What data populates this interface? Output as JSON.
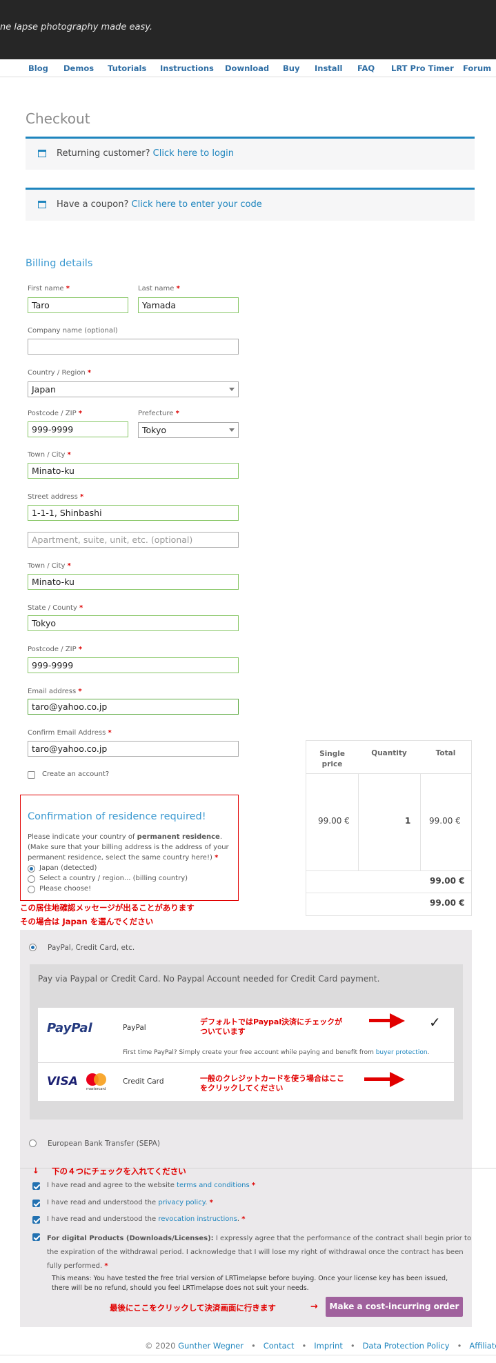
{
  "header": {
    "tagline": "ne lapse photography made easy."
  },
  "nav": {
    "items": [
      "Blog",
      "Demos",
      "Tutorials",
      "Instructions",
      "Download",
      "Buy",
      "Install",
      "FAQ",
      "LRT Pro Timer",
      "Forum"
    ]
  },
  "page_title": "Checkout",
  "notices": {
    "returning": {
      "text": "Returning customer?",
      "link": "Click here to login"
    },
    "coupon": {
      "text": "Have a coupon?",
      "link": "Click here to enter your code"
    }
  },
  "billing": {
    "heading": "Billing details",
    "first_name": {
      "label": "First name",
      "value": "Taro"
    },
    "last_name": {
      "label": "Last name",
      "value": "Yamada"
    },
    "company": {
      "label": "Company name (optional)",
      "value": ""
    },
    "country": {
      "label": "Country / Region",
      "value": "Japan"
    },
    "postcode1": {
      "label": "Postcode / ZIP",
      "value": "999-9999"
    },
    "prefecture": {
      "label": "Prefecture",
      "value": "Tokyo"
    },
    "town1": {
      "label": "Town / City",
      "value": "Minato-ku"
    },
    "street": {
      "label": "Street address",
      "value": "1-1-1, Shinbashi",
      "placeholder2": "Apartment, suite, unit, etc. (optional)"
    },
    "town2": {
      "label": "Town / City",
      "value": "Minato-ku"
    },
    "state": {
      "label": "State / County",
      "value": "Tokyo"
    },
    "postcode2": {
      "label": "Postcode / ZIP",
      "value": "999-9999"
    },
    "email": {
      "label": "Email address",
      "value": "taro@yahoo.co.jp"
    },
    "confirm_email": {
      "label": "Confirm Email Address",
      "value": "taro@yahoo.co.jp"
    },
    "req_mark": "*",
    "create_account": "Create an account?"
  },
  "residence": {
    "heading": "Confirmation of residence required!",
    "text_pre": "Please indicate your country of ",
    "text_bold": "permanent residence",
    "text_post": ".",
    "text2": "(Make sure that your billing address is the address of your",
    "text3": "permanent residence, select the same country here!)",
    "options": [
      "Japan (detected)",
      "Select a country / region... (billing country)",
      "Please choose!"
    ]
  },
  "order": {
    "headers": {
      "single_price": [
        "Single",
        "price"
      ],
      "quantity": "Quantity",
      "total": "Total"
    },
    "row": {
      "price": "99.00 €",
      "qty": "1",
      "total": "99.00 €"
    },
    "subtotal": "99.00 €",
    "grand_total": "99.00 €"
  },
  "annotations": {
    "residence_note_1": "この居住地確認メッセージが出ることがあります",
    "residence_note_2": "その場合は Japan を選んでください",
    "paypal_note_1": "デフォルトではPaypal決済にチェックが",
    "paypal_note_2": "ついています",
    "card_note_1": "一般のクレジットカードを使う場合はここ",
    "card_note_2": "をクリックしてください",
    "check_note": "下の４つにチェックを入れてください",
    "check_arrow": "↓",
    "order_note": "最後にここをクリックして決済画面に行きます",
    "order_arrow": "→"
  },
  "payment": {
    "paypal_option": "PayPal, Credit Card, etc.",
    "desc": "Pay via Paypal or Credit Card. No Paypal Account needed for Credit Card payment.",
    "paypal_logo": "PayPal",
    "paypal_label": "PayPal",
    "paypal_sub": "First time PayPal? Simply create your free account while paying and benefit from ",
    "paypal_sub_link": "buyer protection",
    "paypal_sub_end": ".",
    "checkmark": "✓",
    "visa": "VISA",
    "mastercard": "mastercard",
    "card_label": "Credit Card",
    "sepa_option": "European Bank Transfer (SEPA)"
  },
  "terms": {
    "t1_pre": "I have read and agree to the website ",
    "t1_link": "terms and conditions",
    "t2_pre": "I have read and understood the ",
    "t2_link": "privacy policy",
    "t3_pre": "I have read and understood the ",
    "t3_link": "revocation instructions",
    "t4_bold": "For digital Products (Downloads/Licenses):",
    "t4_line1": " I expressly agree that the performance of the contract shall begin prior to",
    "t4_line2": "the expiration of the withdrawal period. I acknowledge that I will lose my right of withdrawal once the contract has been",
    "t4_line3": "fully performed.",
    "means1": "This means: You have tested the free trial version of LRTimelapse before buying. Once your license key has been issued,",
    "means2": "there will be no refund, should you feel LRTimelapse does not suit your needs.",
    "dot": "."
  },
  "order_button": "Make a cost-incurring order",
  "footer": {
    "copyright": "© 2020 ",
    "author": "Gunther Wegner",
    "sep": "•",
    "links": [
      "Contact",
      "Imprint",
      "Data Protection Policy",
      "Affiliate"
    ]
  },
  "colors": {
    "accent": "#1e85be",
    "button": "#a0619d",
    "valid": "#86c664",
    "annotation": "#e10000"
  }
}
